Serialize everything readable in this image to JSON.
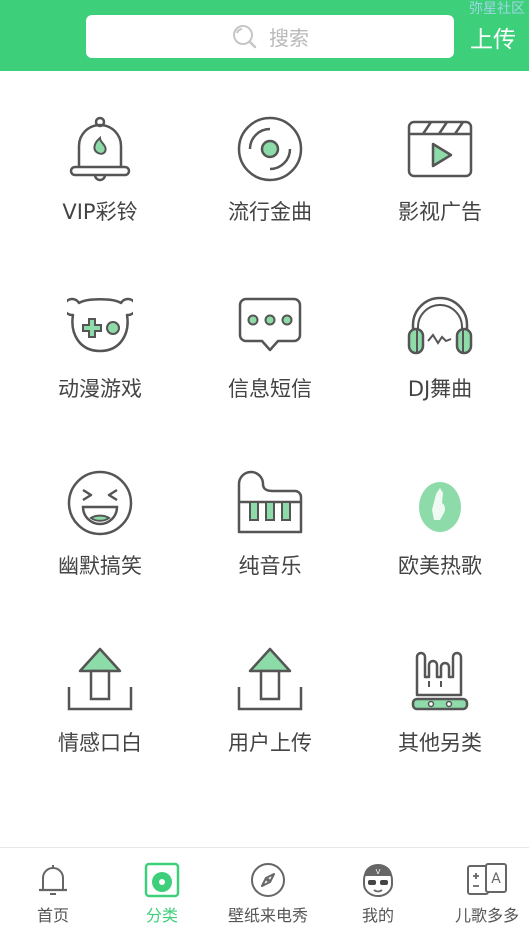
{
  "header": {
    "search_placeholder": "搜索",
    "upload_label": "上传",
    "watermark": "弥星社区"
  },
  "categories": [
    {
      "label": "VIP彩铃",
      "icon": "bell-icon"
    },
    {
      "label": "流行金曲",
      "icon": "vinyl-record-icon"
    },
    {
      "label": "影视广告",
      "icon": "clapperboard-icon"
    },
    {
      "label": "动漫游戏",
      "icon": "game-controller-icon"
    },
    {
      "label": "信息短信",
      "icon": "message-bubble-icon"
    },
    {
      "label": "DJ舞曲",
      "icon": "headphones-icon"
    },
    {
      "label": "幽默搞笑",
      "icon": "laughing-face-icon"
    },
    {
      "label": "纯音乐",
      "icon": "piano-icon"
    },
    {
      "label": "欧美热歌",
      "icon": "rock-hand-badge-icon"
    },
    {
      "label": "情感口白",
      "icon": "upload-arrow-icon"
    },
    {
      "label": "用户上传",
      "icon": "upload-arrow-icon"
    },
    {
      "label": "其他另类",
      "icon": "rock-hand-icon"
    }
  ],
  "tabs": [
    {
      "label": "首页",
      "icon": "bell-icon",
      "active": false
    },
    {
      "label": "分类",
      "icon": "category-disc-icon",
      "active": true
    },
    {
      "label": "壁纸来电秀",
      "icon": "compass-icon",
      "active": false
    },
    {
      "label": "我的",
      "icon": "avatar-icon",
      "active": false
    },
    {
      "label": "儿歌多多",
      "icon": "abc-cards-icon",
      "active": false
    }
  ],
  "colors": {
    "accent": "#3dcf7a",
    "icon_stroke": "#555555",
    "icon_fill": "#8ddba8"
  }
}
